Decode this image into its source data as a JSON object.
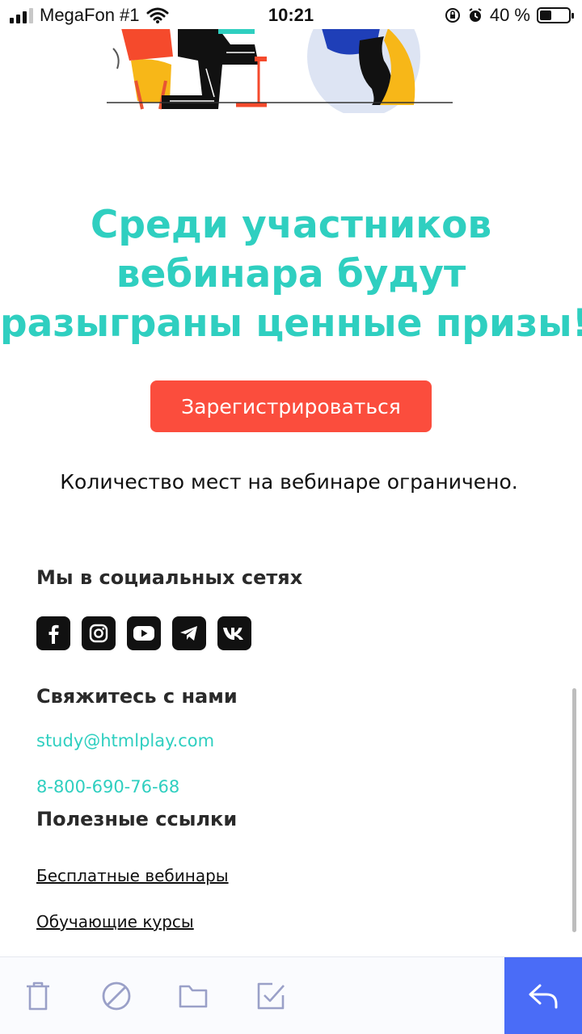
{
  "status_bar": {
    "carrier": "MegaFon #1",
    "time": "10:21",
    "battery_text": "40 %",
    "battery_level": 0.4
  },
  "headline": {
    "line1": "Среди участников",
    "line2": "вебинара будут",
    "line3": "разыграны ценные призы!"
  },
  "cta": {
    "label": "Зарегистрироваться"
  },
  "notice": "Количество мест на вебинаре ограничено.",
  "social": {
    "title": "Мы в социальных сетях",
    "icons": [
      "facebook-icon",
      "instagram-icon",
      "youtube-icon",
      "telegram-icon",
      "vk-icon"
    ]
  },
  "contact": {
    "title": "Свяжитесь с нами",
    "email": "study@htmlplay.com",
    "phone": "8-800-690-76-68"
  },
  "links": {
    "title": "Полезные ссылки",
    "items": [
      "Бесплатные вебинары",
      "Обучающие курсы"
    ]
  },
  "toolbar": {
    "icons": [
      "trash-icon",
      "block-icon",
      "folder-icon",
      "mark-done-icon",
      "reply-icon"
    ]
  },
  "colors": {
    "accent": "#2fcfc0",
    "cta": "#fb4d3d",
    "reply": "#4a6cf7",
    "toolbar_icon": "#9aa0c8"
  }
}
